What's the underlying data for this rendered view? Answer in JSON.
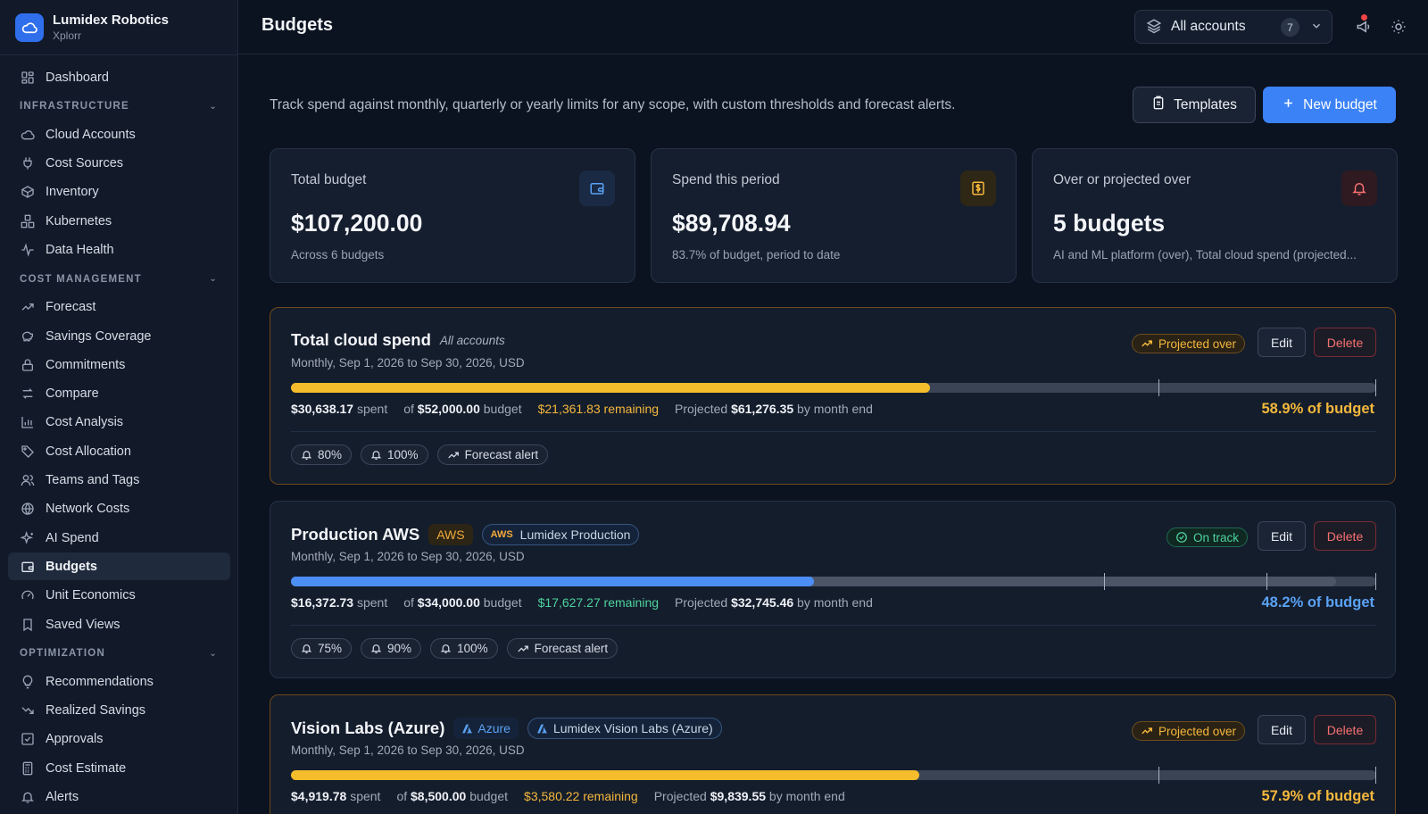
{
  "brand": {
    "name": "Lumidex Robotics",
    "sub": "Xplorr"
  },
  "nav": {
    "dashboard": "Dashboard",
    "sections": [
      {
        "label": "INFRASTRUCTURE",
        "items": [
          "Cloud Accounts",
          "Cost Sources",
          "Inventory",
          "Kubernetes",
          "Data Health"
        ]
      },
      {
        "label": "COST MANAGEMENT",
        "items": [
          "Forecast",
          "Savings Coverage",
          "Commitments",
          "Compare",
          "Cost Analysis",
          "Cost Allocation",
          "Teams and Tags",
          "Network Costs",
          "AI Spend",
          "Budgets",
          "Unit Economics",
          "Saved Views"
        ]
      },
      {
        "label": "OPTIMIZATION",
        "items": [
          "Recommendations",
          "Realized Savings",
          "Approvals",
          "Cost Estimate",
          "Alerts"
        ]
      }
    ],
    "active": "Budgets"
  },
  "header": {
    "title": "Budgets",
    "account_select": "All accounts",
    "account_count": "7"
  },
  "intro": "Track spend against monthly, quarterly or yearly limits for any scope, with custom thresholds and forecast alerts.",
  "buttons": {
    "templates": "Templates",
    "new_budget": "New budget",
    "edit": "Edit",
    "delete": "Delete"
  },
  "stats": [
    {
      "label": "Total budget",
      "value": "$107,200.00",
      "sub": "Across 6 budgets",
      "icon": "wallet-icon",
      "color": "#5aa2f4"
    },
    {
      "label": "Spend this period",
      "value": "$89,708.94",
      "sub": "83.7% of budget, period to date",
      "icon": "dollar-receipt-icon",
      "color": "#f5b83c"
    },
    {
      "label": "Over or projected over",
      "value": "5 budgets",
      "sub": "AI and ML platform (over), Total cloud spend (projected...",
      "icon": "bell-alert-icon",
      "color": "#f87171"
    }
  ],
  "budgets": [
    {
      "title": "Total cloud spend",
      "scope": "All accounts",
      "period": "Monthly, Sep 1, 2026 to Sep 30, 2026, USD",
      "status": "Projected over",
      "progress": 0.589,
      "thresholds": [
        0.8,
        1.0
      ],
      "spent": "$30,638.17",
      "spent_label": "spent",
      "budget_prefix": "of",
      "budget": "$52,000.00",
      "budget_label": "budget",
      "remaining": "$21,361.83 remaining",
      "projected_label": "Projected",
      "projected": "$61,276.35",
      "projected_suffix": "by month end",
      "pct": "58.9% of budget",
      "alerts": [
        "80%",
        "100%",
        "Forecast alert"
      ]
    },
    {
      "title": "Production AWS",
      "provider_tag": "AWS",
      "scope_mini": "AWS",
      "scope": "Lumidex Production",
      "period": "Monthly, Sep 1, 2026 to Sep 30, 2026, USD",
      "status": "On track",
      "progress": 0.482,
      "projected_progress": 0.963,
      "thresholds": [
        0.75,
        0.9,
        1.0
      ],
      "spent": "$16,372.73",
      "spent_label": "spent",
      "budget_prefix": "of",
      "budget": "$34,000.00",
      "budget_label": "budget",
      "remaining": "$17,627.27 remaining",
      "projected_label": "Projected",
      "projected": "$32,745.46",
      "projected_suffix": "by month end",
      "pct": "48.2% of budget",
      "alerts": [
        "75%",
        "90%",
        "100%",
        "Forecast alert"
      ]
    },
    {
      "title": "Vision Labs (Azure)",
      "provider_tag": "Azure",
      "scope": "Lumidex Vision Labs (Azure)",
      "period": "Monthly, Sep 1, 2026 to Sep 30, 2026, USD",
      "status": "Projected over",
      "progress": 0.579,
      "thresholds": [
        0.8,
        1.0
      ],
      "spent": "$4,919.78",
      "spent_label": "spent",
      "budget_prefix": "of",
      "budget": "$8,500.00",
      "budget_label": "budget",
      "remaining": "$3,580.22 remaining",
      "projected_label": "Projected",
      "projected": "$9,839.55",
      "projected_suffix": "by month end",
      "pct": "57.9% of budget"
    }
  ]
}
